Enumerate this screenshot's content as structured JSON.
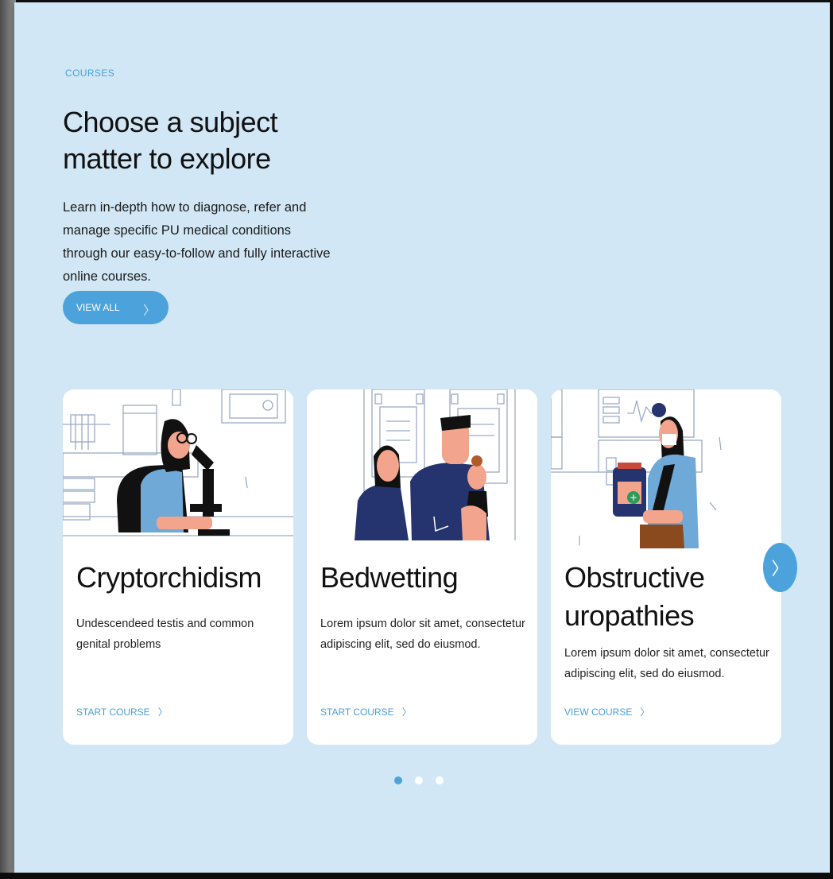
{
  "section": {
    "eyebrow": "COURSES",
    "headline": "Choose a subject matter to explore",
    "intro": "Learn in-depth how to diagnose, refer and manage specific PU medical conditions through our easy-to-follow and fully interactive online courses.",
    "view_all_label": "VIEW ALL",
    "view_all_chevron": "〉"
  },
  "cards": [
    {
      "title": "Cryptorchidism",
      "description": "Undescendeed testis and common genital problems",
      "cta_label": "START COURSE",
      "cta_chevron": "〉",
      "illustration": "doctor-microscope-illustration"
    },
    {
      "title": "Bedwetting",
      "description": "Lorem ipsum dolor sit amet, consectetur adipiscing elit, sed do eiusmod.",
      "cta_label": "START COURSE",
      "cta_chevron": "〉",
      "illustration": "family-illustration"
    },
    {
      "title": "Obstructive uropathies",
      "description": "Lorem ipsum dolor sit amet, consectetur adipiscing elit, sed do eiusmod.",
      "cta_label": "VIEW COURSE",
      "cta_chevron": "〉",
      "illustration": "doctor-medicine-jar-illustration"
    }
  ],
  "carousel": {
    "next_icon": "〉",
    "pages": 3,
    "active_page": 1
  },
  "colors": {
    "background": "#d1e7f5",
    "accent": "#4ca3dc",
    "dot_inactive": "#ffffff"
  }
}
